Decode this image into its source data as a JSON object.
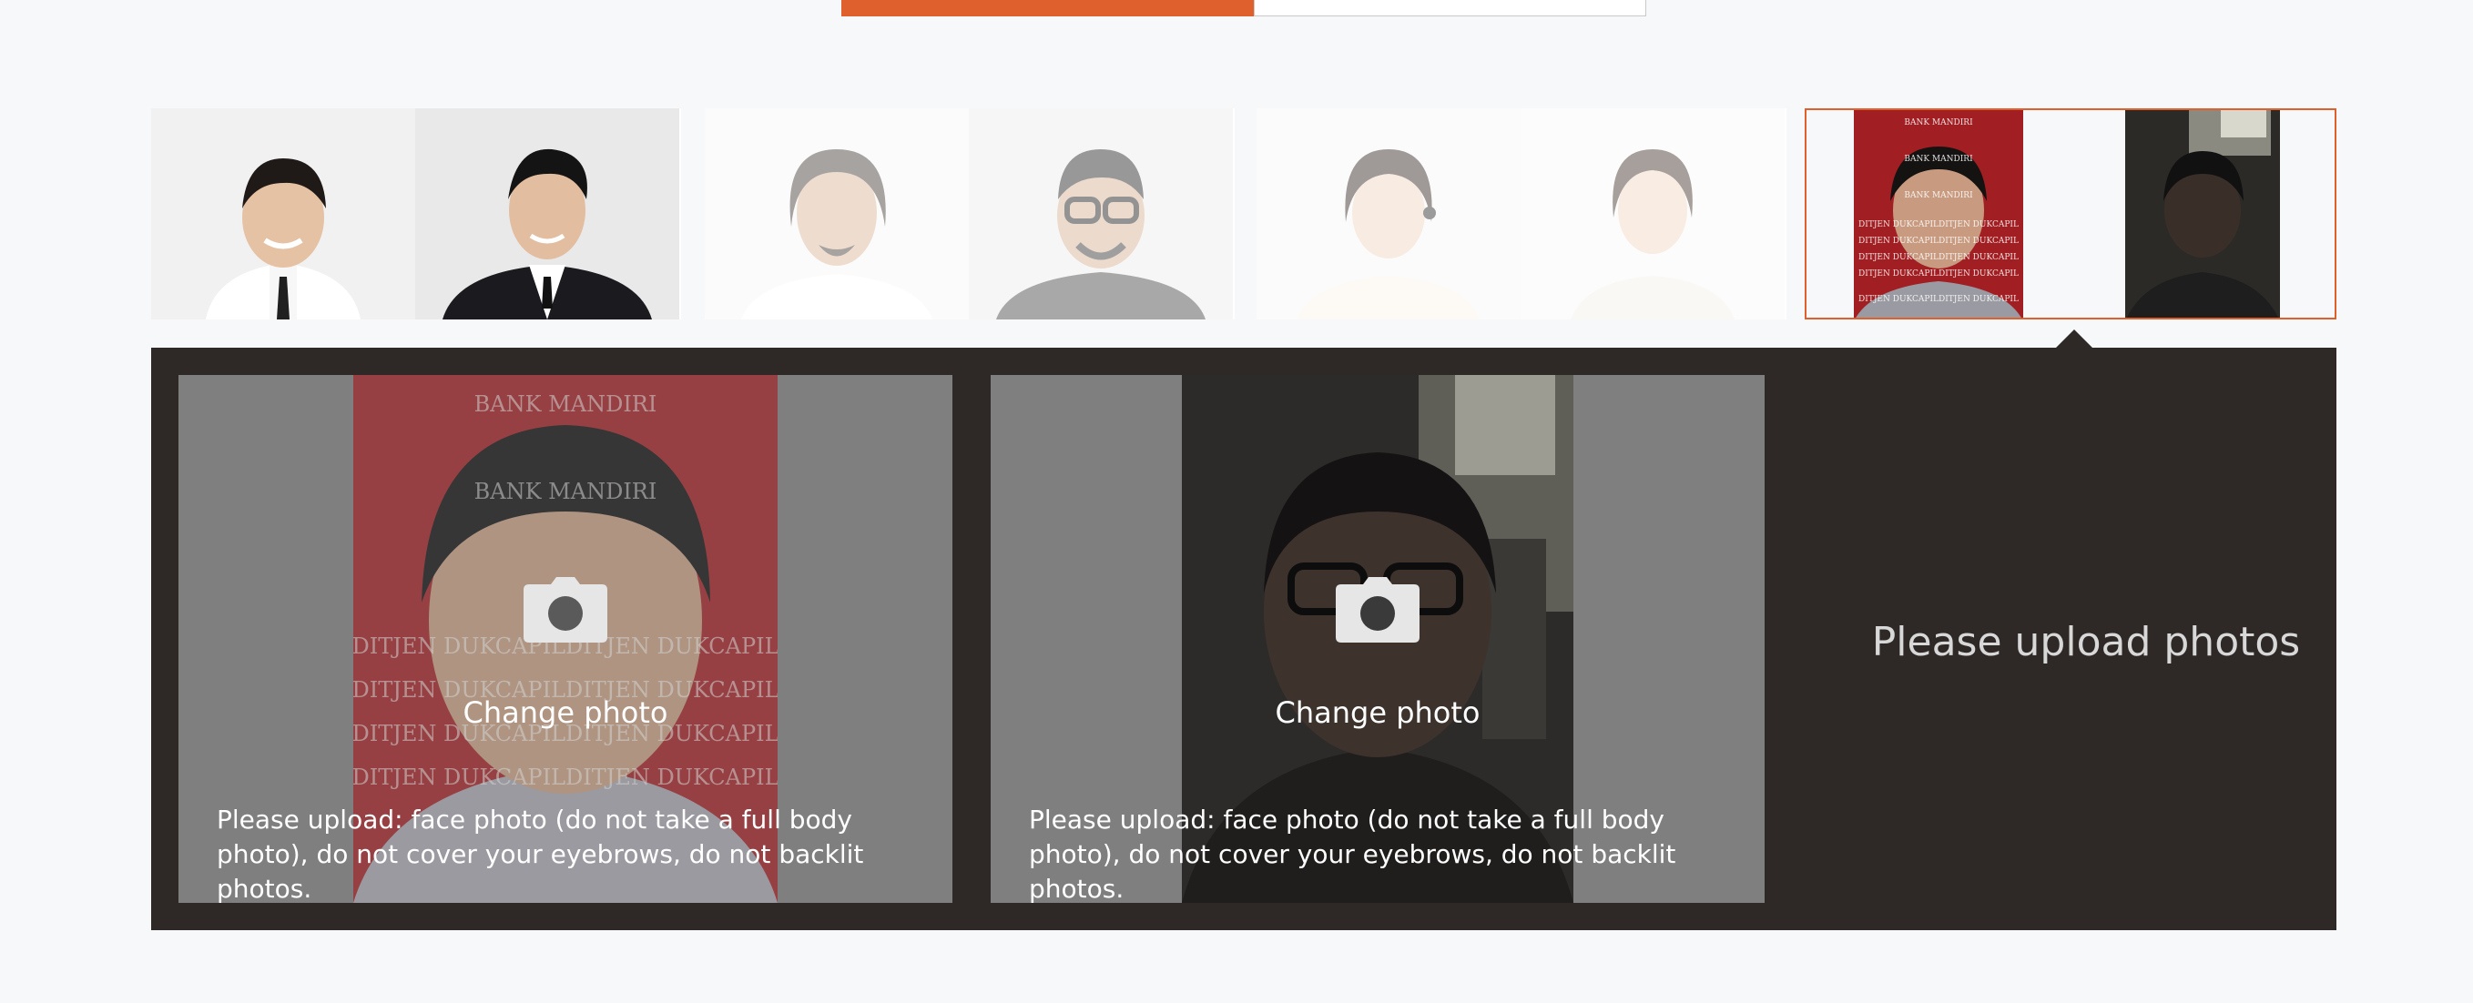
{
  "tabs": [
    {
      "label": "",
      "active": true
    },
    {
      "label": "",
      "active": false
    }
  ],
  "thumbnails": [
    {
      "name": "example-men-suits",
      "selected": false
    },
    {
      "name": "example-men-casual",
      "selected": false
    },
    {
      "name": "example-women",
      "selected": false
    },
    {
      "name": "uploaded-pair",
      "selected": true
    }
  ],
  "upload_cards": [
    {
      "change_label": "Change photo",
      "hint": "Please upload: face photo (do not take a full body photo), do not cover your eyebrows, do not backlit photos.",
      "overlay_texts": [
        "BANK MANDIRI",
        "BANK MANDIRI",
        "DITJEN DUKCAPILDITJEN DUKCAPIL",
        "DITJEN DUKCAPILDITJEN DUKCAPIL",
        "DITJEN DUKCAPILDITJEN DUKCAPIL",
        "DITJEN DUKCAPILDITJEN DUKCAPIL"
      ]
    },
    {
      "change_label": "Change photo",
      "hint": "Please upload: face photo (do not take a full body photo), do not cover your eyebrows, do not backlit photos."
    }
  ],
  "result_message": "Please upload photos",
  "colors": {
    "accent": "#e0602d",
    "panel": "#2e2826",
    "card": "#7f7f7f"
  },
  "icons": [
    "camera-icon"
  ]
}
